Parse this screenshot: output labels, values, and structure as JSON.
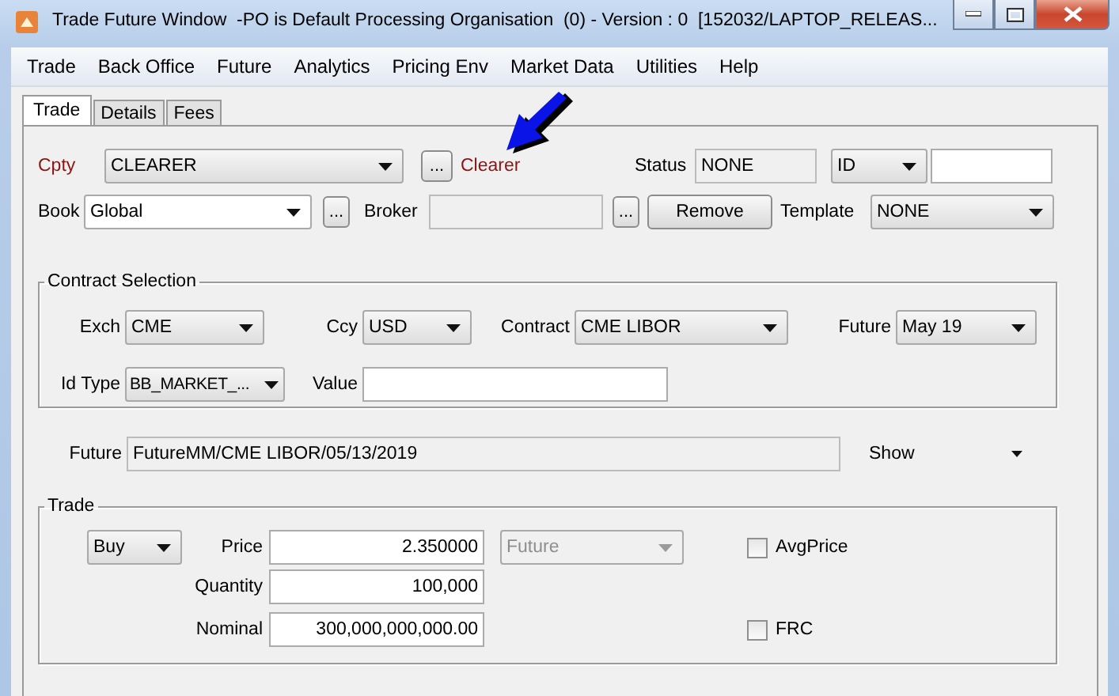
{
  "window": {
    "title": "Trade Future Window  -PO is Default Processing Organisation  (0) - Version : 0  [152032/LAPTOP_RELEAS..."
  },
  "menu": [
    "Trade",
    "Back Office",
    "Future",
    "Analytics",
    "Pricing Env",
    "Market Data",
    "Utilities",
    "Help"
  ],
  "tabs": [
    {
      "label": "Trade",
      "selected": true
    },
    {
      "label": "Details",
      "selected": false
    },
    {
      "label": "Fees",
      "selected": false
    }
  ],
  "header": {
    "cpty": {
      "label": "Cpty",
      "value": "CLEARER",
      "browse": "..."
    },
    "cpty_name": "Clearer",
    "status": {
      "label": "Status",
      "value": "NONE",
      "disabled": true
    },
    "id": {
      "type": "ID"
    },
    "book": {
      "label": "Book",
      "value": "Global",
      "browse": "..."
    },
    "broker": {
      "label": "Broker",
      "disabled": true,
      "browse": "..."
    },
    "remove_button": "Remove",
    "template": {
      "label": "Template",
      "value": "NONE"
    }
  },
  "contract_selection": {
    "title": "Contract Selection",
    "exch": {
      "label": "Exch",
      "value": "CME"
    },
    "ccy": {
      "label": "Ccy",
      "value": "USD"
    },
    "contract": {
      "label": "Contract",
      "value": "CME LIBOR"
    },
    "future": {
      "label": "Future",
      "value": "May 19"
    },
    "id_type": {
      "label": "Id Type",
      "value": "BB_MARKET_..."
    },
    "value": {
      "label": "Value"
    }
  },
  "future": {
    "label": "Future",
    "value": "FutureMM/CME LIBOR/05/13/2019",
    "show": "Show",
    "disabled": true
  },
  "trade": {
    "title": "Trade",
    "direction": "Buy",
    "price": {
      "label": "Price",
      "value": "2.350000"
    },
    "price_type": {
      "value": "Future",
      "disabled": true
    },
    "quantity": {
      "label": "Quantity",
      "value": "100,000"
    },
    "nominal": {
      "label": "Nominal",
      "value": "300,000,000,000.00"
    },
    "avg_price": {
      "label": "AvgPrice",
      "checked": false
    },
    "frc": {
      "label": "FRC",
      "checked": false
    }
  }
}
